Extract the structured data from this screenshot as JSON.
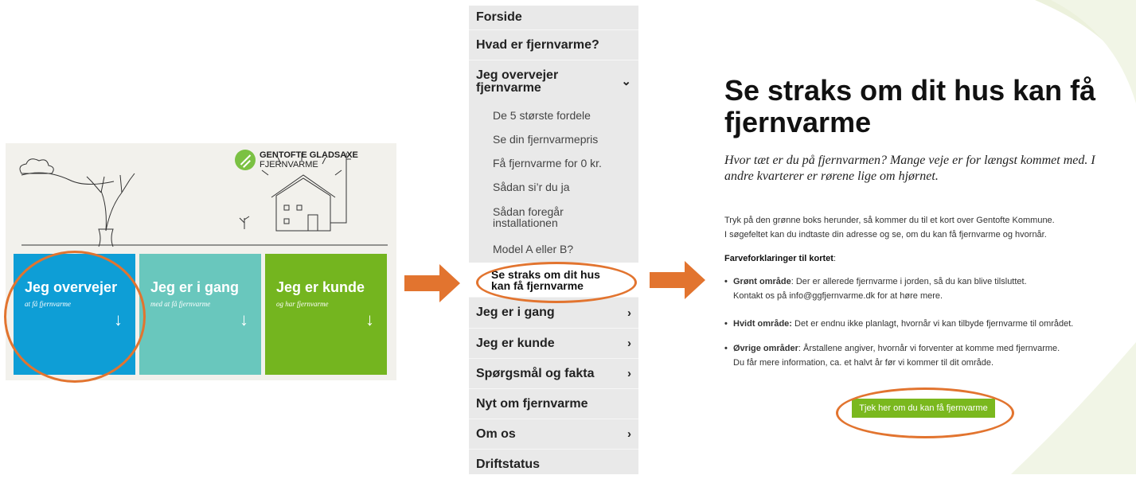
{
  "hero": {
    "logo": {
      "line1": "GENTOFTE GLADSAXE",
      "line2": "FJERNVARME"
    },
    "tiles": [
      {
        "title": "Jeg overvejer",
        "subtitle": "at få fjernvarme",
        "arrow": "↓"
      },
      {
        "title": "Jeg er i gang",
        "subtitle": "med at få fjernvarme",
        "arrow": "↓"
      },
      {
        "title": "Jeg er kunde",
        "subtitle": "og har fjernvarme",
        "arrow": "↓"
      }
    ]
  },
  "menu": {
    "items": [
      {
        "label": "Forside"
      },
      {
        "label": "Hvad er fjernvarme?"
      },
      {
        "label": "Jeg overvejer fjernvarme",
        "chevron": "⌄"
      }
    ],
    "sub_items": [
      {
        "label": "De 5 største fordele"
      },
      {
        "label": "Se din fjernvarmepris"
      },
      {
        "label": "Få fjernvarme for 0 kr."
      },
      {
        "label": "Sådan si’r du ja"
      },
      {
        "label": "Sådan foregår installationen"
      },
      {
        "label": "Model A eller B?"
      },
      {
        "label": "Se straks om dit hus kan få fjernvarme"
      }
    ],
    "items_after": [
      {
        "label": "Jeg er i gang",
        "chevron": "›"
      },
      {
        "label": "Jeg er kunde",
        "chevron": "›"
      },
      {
        "label": "Spørgsmål og fakta",
        "chevron": "›"
      },
      {
        "label": "Nyt om fjernvarme"
      },
      {
        "label": "Om os",
        "chevron": "›"
      },
      {
        "label": "Driftstatus"
      }
    ]
  },
  "page": {
    "title": "Se straks om dit hus kan få fjernvarme",
    "lead": "Hvor tæt er du på fjernvarmen? Mange veje er for længst kommet med. I andre kvarterer er rørene lige om hjørnet.",
    "intro1": "Tryk på den grønne boks herunder, så kommer du til et kort over Gentofte Kommune.",
    "intro2": "I søgefeltet kan du indtaste din adresse og se, om du kan få fjernvarme og hvornår.",
    "legend_heading": "Farveforklaringer til kortet",
    "legend_colon": ":",
    "bullet_char": "•",
    "bullets": [
      {
        "term": "Grønt område",
        "text": ": Der er allerede fjernvarme i jorden, så du kan blive tilsluttet.",
        "line2_pre": "Kontakt os på ",
        "line2_link": "info@ggfjernvarme.dk",
        "line2_post": " for at høre mere."
      },
      {
        "term": "Hvidt område:",
        "text": " Det er endnu ikke planlagt, hvornår vi kan tilbyde fjernvarme til området."
      },
      {
        "term": "Øvrige områder",
        "text": ": Årstallene angiver, hvornår vi forventer at komme med fjernvarme.",
        "line2_pre": "Du får mere information, ca. et halvt år før vi kommer til dit område."
      }
    ],
    "cta_label": "Tjek her om du kan få fjernvarme"
  },
  "colors": {
    "accent_orange": "#e2742f",
    "tile_blue": "#0e9ed6",
    "tile_teal": "#69c7bd",
    "tile_green": "#74b51f",
    "cta_green": "#7ab81e",
    "menu_bg": "#e9e9e9"
  }
}
